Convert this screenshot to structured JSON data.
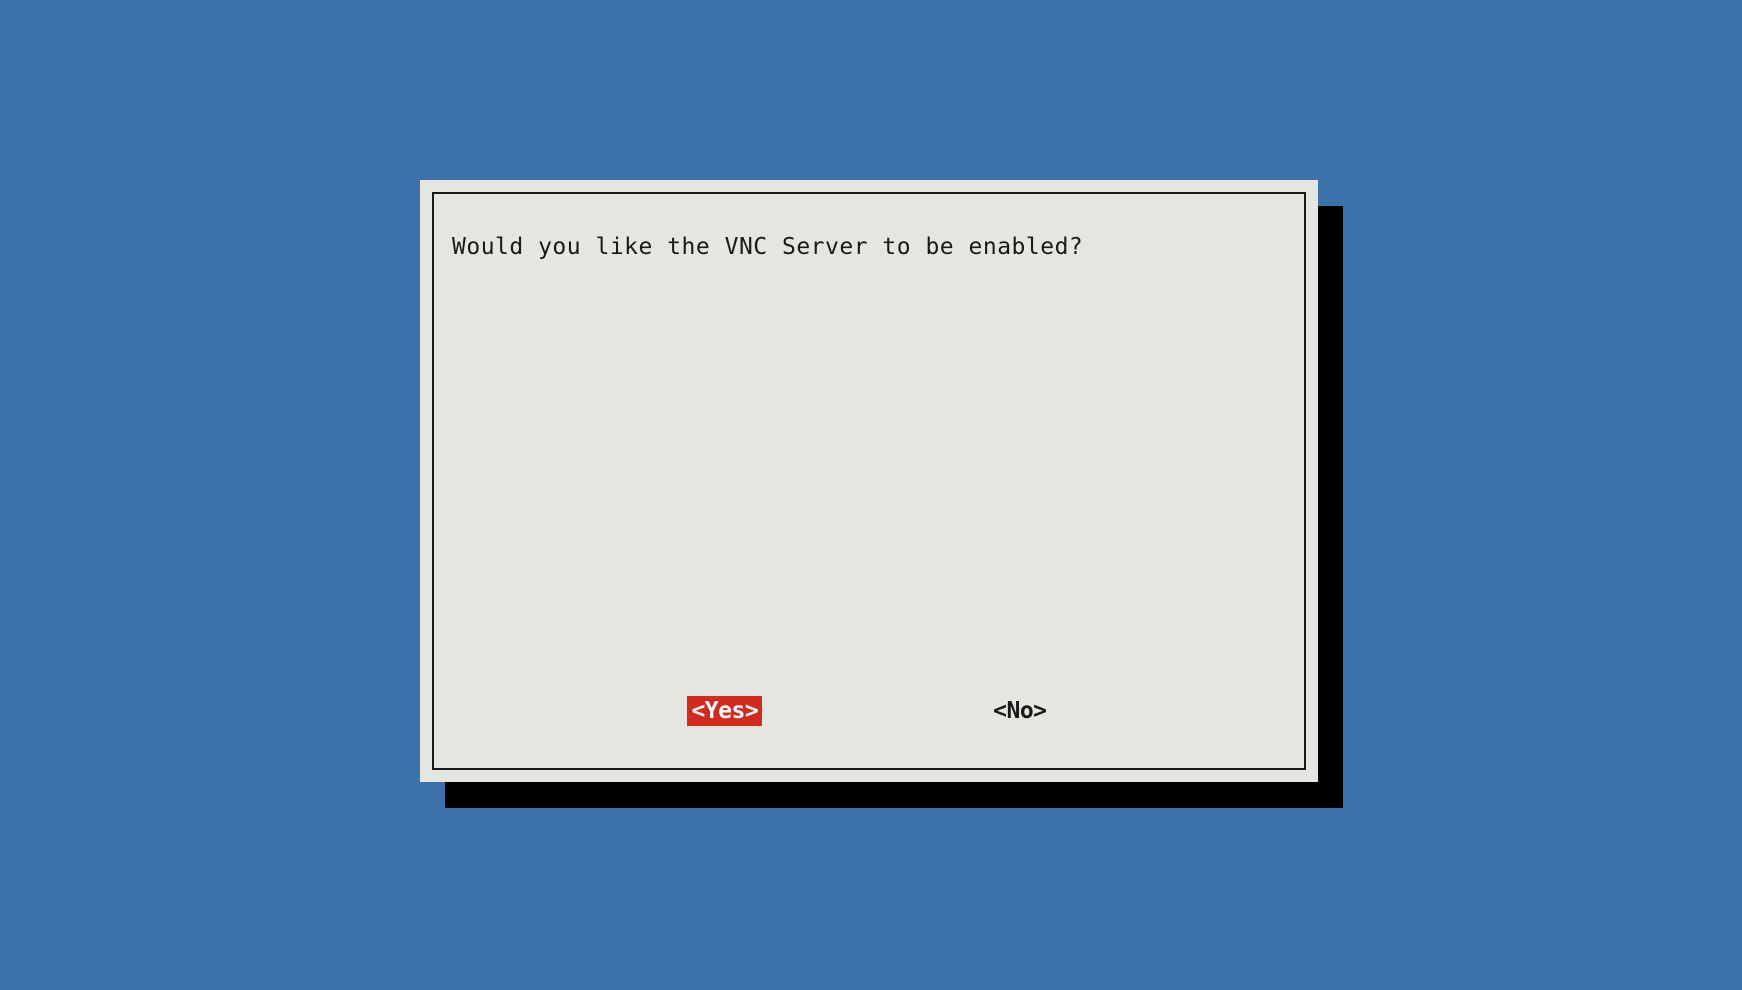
{
  "dialog": {
    "message": "Would you like the VNC Server to be enabled?",
    "buttons": {
      "yes": "<Yes>",
      "no": "<No>"
    },
    "selected": "yes"
  },
  "colors": {
    "background": "#3c72aa",
    "dialog_bg": "#e6e6e0",
    "selected_bg": "#d22a1e",
    "selected_fg": "#ffffff",
    "text": "#1a1a1a",
    "shadow": "#000000"
  }
}
